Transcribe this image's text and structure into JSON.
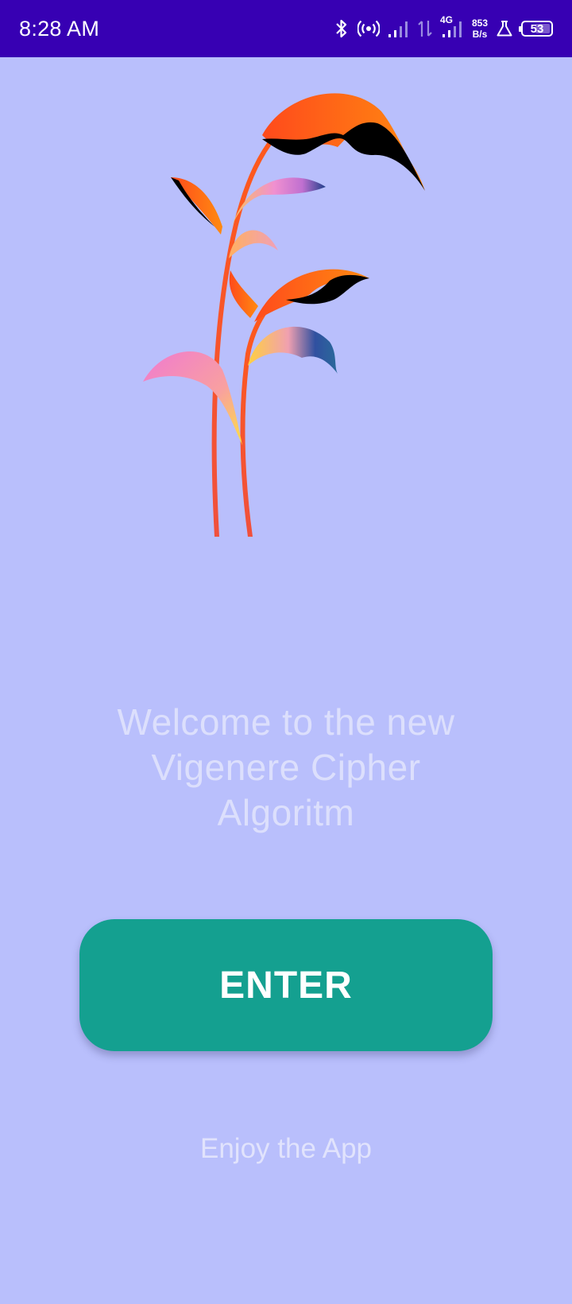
{
  "status_bar": {
    "time": "8:28 AM",
    "network_type": "4G",
    "speed_value": "853",
    "speed_unit": "B/s",
    "battery_level": "53",
    "background_color": "#3700b3"
  },
  "main": {
    "background_color": "#b9bffc",
    "logo_icon": "plant-logo-icon",
    "welcome_text": "Welcome to the new Vigenere Cipher Algoritm",
    "enter_button_label": "ENTER",
    "enter_button_color": "#14a090",
    "footer_text": "Enjoy the App"
  }
}
